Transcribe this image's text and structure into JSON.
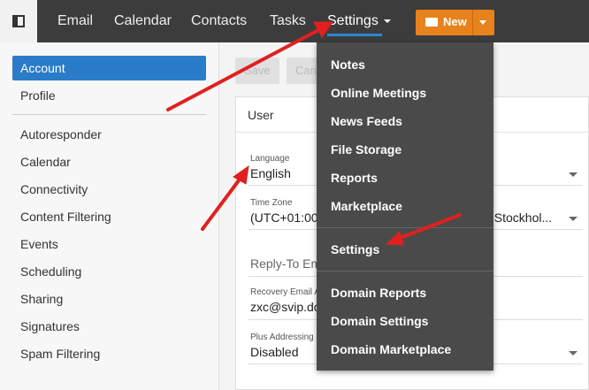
{
  "topnav": {
    "items": [
      "Email",
      "Calendar",
      "Contacts",
      "Tasks"
    ],
    "settings_label": "Settings",
    "new_label": "New"
  },
  "sidebar": {
    "primary": [
      "Account",
      "Profile"
    ],
    "secondary": [
      "Autoresponder",
      "Calendar",
      "Connectivity",
      "Content Filtering",
      "Events",
      "Scheduling",
      "Sharing",
      "Signatures",
      "Spam Filtering"
    ]
  },
  "toolbar": {
    "save_label": "Save",
    "cancel_label": "Canc"
  },
  "panel": {
    "title": "User",
    "language_label": "Language",
    "language_value": "English",
    "timezone_label": "Time Zone",
    "timezone_value": "(UTC+01:00)",
    "timezone_value_tail": ", Stockhol...",
    "replyto_placeholder": "Reply-To Em",
    "recovery_label": "Recovery Email A",
    "recovery_value": "zxc@svip.dc",
    "plus_label": "Plus Addressing",
    "plus_value": "Disabled"
  },
  "settings_menu": {
    "group1": [
      "Notes",
      "Online Meetings",
      "News Feeds",
      "File Storage",
      "Reports",
      "Marketplace"
    ],
    "group2": [
      "Settings"
    ],
    "group3": [
      "Domain Reports",
      "Domain Settings",
      "Domain Marketplace"
    ]
  },
  "colors": {
    "topbar": "#3c3c3c",
    "accent_blue": "#2b7cc8",
    "new_button": "#e8821c",
    "menu_bg": "#4a4a4a",
    "annotation_arrow": "#e02020"
  }
}
